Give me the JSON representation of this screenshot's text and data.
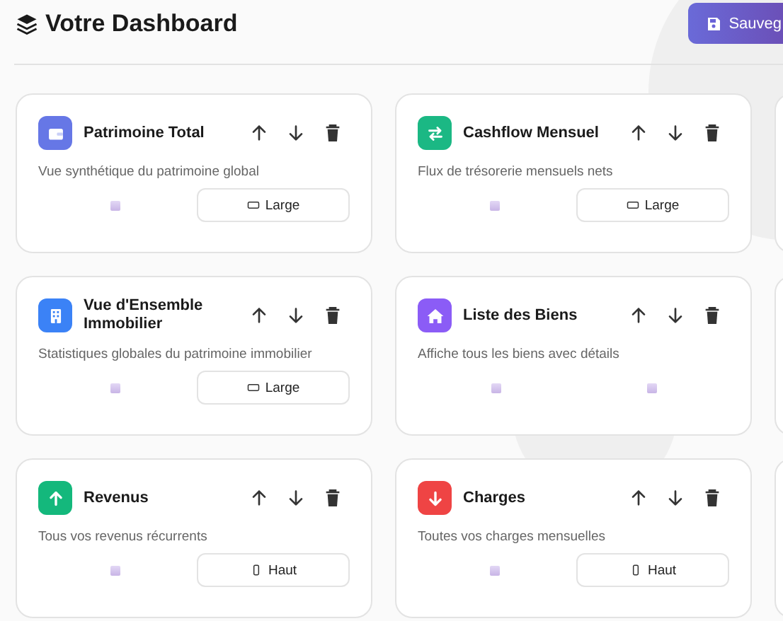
{
  "header": {
    "title": "Votre Dashboard",
    "save_button": "Sauveg"
  },
  "widgets": [
    {
      "title": "Patrimoine Total",
      "description": "Vue synthétique du patrimoine global",
      "kind": "wallet",
      "color": "#6677e6",
      "footer": [
        {
          "kind": "marker"
        },
        {
          "kind": "wide",
          "label": "Large"
        }
      ]
    },
    {
      "title": "Cashflow Mensuel",
      "description": "Flux de trésorerie mensuels nets",
      "kind": "exchange",
      "color": "#1bb884",
      "footer": [
        {
          "kind": "marker"
        },
        {
          "kind": "wide",
          "label": "Large"
        }
      ]
    },
    {
      "title": "Vue d'Ensemble Immobilier",
      "description": "Statistiques globales du patrimoine immobilier",
      "kind": "building",
      "color": "#3b82f6",
      "footer": [
        {
          "kind": "marker"
        },
        {
          "kind": "wide",
          "label": "Large"
        }
      ]
    },
    {
      "title": "Liste des Biens",
      "description": "Affiche tous les biens avec détails",
      "kind": "home",
      "color": "#8b5cf6",
      "footer": [
        {
          "kind": "marker"
        },
        {
          "kind": "marker"
        }
      ]
    },
    {
      "title": "Revenus",
      "description": "Tous vos revenus récurrents",
      "kind": "income",
      "color": "#14b87c",
      "footer": [
        {
          "kind": "marker"
        },
        {
          "kind": "tall",
          "label": "Haut"
        }
      ]
    },
    {
      "title": "Charges",
      "description": "Toutes vos charges mensuelles",
      "kind": "expense",
      "color": "#ef4444",
      "footer": [
        {
          "kind": "marker"
        },
        {
          "kind": "tall",
          "label": "Haut"
        }
      ]
    }
  ]
}
